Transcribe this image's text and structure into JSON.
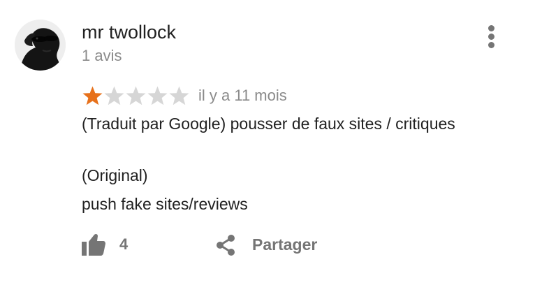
{
  "review": {
    "author": "mr twollock",
    "review_count": "1 avis",
    "rating": 1,
    "rating_max": 5,
    "date": "il y a 11 mois",
    "translated_text": "(Traduit par Google) pousser de faux sites / critiques",
    "original_label": "(Original)",
    "original_text": "push fake sites/reviews",
    "likes": "4",
    "share_label": "Partager"
  },
  "colors": {
    "star_filled": "#e7711b",
    "star_empty": "#d6d6d6",
    "secondary_text": "#8a8a8a",
    "icon_gray": "#757575"
  },
  "icons": {
    "menu": "more-vert-icon",
    "like": "thumb-up-icon",
    "share": "share-icon"
  }
}
